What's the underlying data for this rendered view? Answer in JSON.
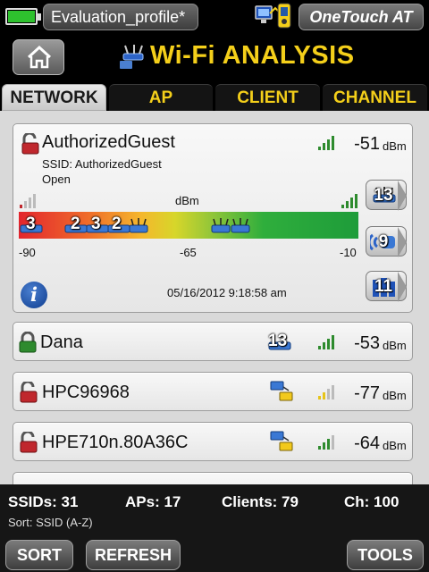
{
  "status_bar": {
    "profile": "Evaluation_profile*",
    "brand": "OneTouch AT",
    "battery_level": 1.0
  },
  "header": {
    "title": "Wi-Fi ANALYSIS",
    "title_color": "#f4cf1a"
  },
  "tabs": [
    {
      "label": "NETWORK",
      "active": true
    },
    {
      "label": "AP",
      "active": false
    },
    {
      "label": "CLIENT",
      "active": false
    },
    {
      "label": "CHANNEL",
      "active": false
    }
  ],
  "expanded_network": {
    "name": "AuthorizedGuest",
    "ssid_line": "SSID: AuthorizedGuest",
    "security": "Open",
    "signal": "-51",
    "unit": "dBm",
    "scale_unit": "dBm",
    "scale_labels": [
      "-90",
      "-65",
      "-10"
    ],
    "ap_clusters": [
      {
        "count": "3"
      },
      {
        "count": "2"
      },
      {
        "count": "3"
      },
      {
        "count": "2"
      }
    ],
    "ap_count": "13",
    "client_count": "9",
    "channel_count": "11",
    "timestamp": "05/16/2012 9:18:58 am",
    "lock_icon": "unlocked-red-lock-icon"
  },
  "networks": [
    {
      "name": "Dana",
      "badge": "13",
      "signal": "-53",
      "unit": "dBm",
      "bars": 4,
      "bar_color": "#2e8b2e",
      "lock": "green-lock-icon"
    },
    {
      "name": "HPC96968",
      "badge": "",
      "signal": "-77",
      "unit": "dBm",
      "bars": 2,
      "bar_color": "#e6c419",
      "lock": "unlocked-red-lock-icon"
    },
    {
      "name": "HPE710n.80A36C",
      "badge": "",
      "signal": "-64",
      "unit": "dBm",
      "bars": 3,
      "bar_color": "#2e8b2e",
      "lock": "unlocked-red-lock-icon"
    }
  ],
  "summary": {
    "ssids": "SSIDs:  31",
    "aps": "APs:  17",
    "clients": "Clients:  79",
    "ch": "Ch:  100",
    "sort": "Sort: SSID (A-Z)"
  },
  "buttons": {
    "sort": "SORT",
    "refresh": "REFRESH",
    "tools": "TOOLS"
  }
}
